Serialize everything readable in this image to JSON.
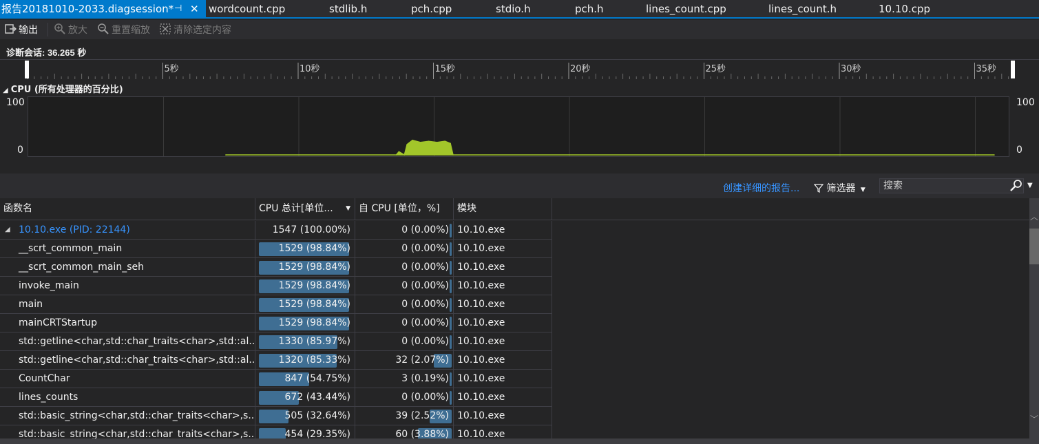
{
  "tabs": [
    {
      "label": "报告20181010-2033.diagsession*",
      "active": true
    },
    {
      "label": "wordcount.cpp"
    },
    {
      "label": "stdlib.h"
    },
    {
      "label": "pch.cpp"
    },
    {
      "label": "stdio.h"
    },
    {
      "label": "pch.h"
    },
    {
      "label": "lines_count.cpp"
    },
    {
      "label": "lines_count.h"
    },
    {
      "label": "10.10.cpp"
    }
  ],
  "active_tab": {
    "label": "报告20181010-2033.diagsession*",
    "pin": "⊣",
    "close": "✕"
  },
  "toolbar": {
    "output": "输出",
    "zoom_in": "放大",
    "reset_zoom": "重置缩放",
    "clear_selection": "清除选定内容"
  },
  "session": {
    "title": "诊断会话: 36.265 秒"
  },
  "ruler": {
    "labels": [
      "5秒",
      "10秒",
      "15秒",
      "20秒",
      "25秒",
      "30秒",
      "35秒"
    ],
    "seconds": [
      5,
      10,
      15,
      20,
      25,
      30,
      35
    ],
    "total_seconds": 36.265
  },
  "cpu_graph": {
    "title": "CPU (所有处理器的百分比)",
    "y_max_label": "100",
    "y_min_label": "0",
    "y_max_label_right": "100",
    "y_min_label_right": "0",
    "line_color": "#a2c62a"
  },
  "chart_data": {
    "type": "area",
    "x": [
      7.3,
      13.6,
      13.7,
      13.9,
      14.0,
      14.2,
      14.5,
      14.8,
      15.1,
      15.4,
      15.6,
      15.7,
      35.7
    ],
    "y": [
      0,
      0,
      6,
      0,
      20,
      28,
      24,
      26,
      24,
      26,
      22,
      0,
      0
    ],
    "ylim": [
      0,
      100
    ],
    "xlim": [
      0,
      36.265
    ]
  },
  "filterbar": {
    "report_link": "创建详细的报告...",
    "filter": "筛选器",
    "search_placeholder": "搜索"
  },
  "table": {
    "columns": [
      "函数名",
      "CPU 总计[单位...",
      "自 CPU [单位，%]",
      "模块"
    ],
    "rows": [
      {
        "name": "10.10.exe (PID: 22144)",
        "total": "1547 (100.00%)",
        "total_pct": 100.0,
        "self": "0 (0.00%)",
        "self_pct": 0.0,
        "module": "10.10.exe",
        "root": true
      },
      {
        "name": "__scrt_common_main",
        "total": "1529 (98.84%)",
        "total_pct": 98.84,
        "self": "0 (0.00%)",
        "self_pct": 0.0,
        "module": "10.10.exe"
      },
      {
        "name": "__scrt_common_main_seh",
        "total": "1529 (98.84%)",
        "total_pct": 98.84,
        "self": "0 (0.00%)",
        "self_pct": 0.0,
        "module": "10.10.exe"
      },
      {
        "name": "invoke_main",
        "total": "1529 (98.84%)",
        "total_pct": 98.84,
        "self": "0 (0.00%)",
        "self_pct": 0.0,
        "module": "10.10.exe"
      },
      {
        "name": "main",
        "total": "1529 (98.84%)",
        "total_pct": 98.84,
        "self": "0 (0.00%)",
        "self_pct": 0.0,
        "module": "10.10.exe"
      },
      {
        "name": "mainCRTStartup",
        "total": "1529 (98.84%)",
        "total_pct": 98.84,
        "self": "0 (0.00%)",
        "self_pct": 0.0,
        "module": "10.10.exe"
      },
      {
        "name": "std::getline<char,std::char_traits<char>,std::al...",
        "total": "1330 (85.97%)",
        "total_pct": 85.97,
        "self": "0 (0.00%)",
        "self_pct": 0.0,
        "module": "10.10.exe"
      },
      {
        "name": "std::getline<char,std::char_traits<char>,std::al...",
        "total": "1320 (85.33%)",
        "total_pct": 85.33,
        "self": "32 (2.07%)",
        "self_pct": 2.07,
        "module": "10.10.exe"
      },
      {
        "name": "CountChar",
        "total": "847 (54.75%)",
        "total_pct": 54.75,
        "self": "3 (0.19%)",
        "self_pct": 0.19,
        "module": "10.10.exe"
      },
      {
        "name": "lines_counts",
        "total": "672 (43.44%)",
        "total_pct": 43.44,
        "self": "0 (0.00%)",
        "self_pct": 0.0,
        "module": "10.10.exe"
      },
      {
        "name": "std::basic_string<char,std::char_traits<char>,s...",
        "total": "505 (32.64%)",
        "total_pct": 32.64,
        "self": "39 (2.52%)",
        "self_pct": 2.52,
        "module": "10.10.exe"
      },
      {
        "name": "std::basic_string<char,std::char_traits<char>,s...",
        "total": "454 (29.35%)",
        "total_pct": 29.35,
        "self": "60 (3.88%)",
        "self_pct": 3.88,
        "module": "10.10.exe"
      }
    ]
  },
  "colors": {
    "accent": "#007acc",
    "link": "#3794ff",
    "bar": "#3f6e93",
    "cpu_line": "#a2c62a"
  }
}
